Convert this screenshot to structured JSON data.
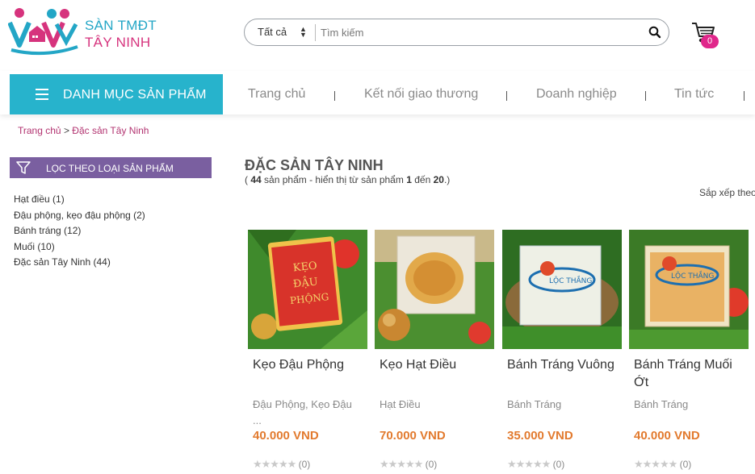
{
  "brand": {
    "line1": "SÀN TMĐT",
    "line2": "TÂY NINH"
  },
  "search": {
    "category": "Tất cả",
    "placeholder": "Tìm kiếm"
  },
  "cart": {
    "count": "0"
  },
  "nav": {
    "category_button": "DANH MỤC SẢN PHẨM",
    "items": [
      "Trang chủ",
      "Kết nối giao thương",
      "Doanh nghiệp",
      "Tin tức"
    ]
  },
  "breadcrumb": {
    "home": "Trang chủ",
    "sep": ">",
    "current": "Đặc sản Tây Ninh"
  },
  "filter": {
    "title": "LỌC THEO LOẠI SẢN PHẨM",
    "items": [
      "Hạt điều (1)",
      "Đậu phộng, kẹo đậu phộng (2)",
      "Bánh tráng (12)",
      "Muối (10)",
      "Đặc sản Tây Ninh (44)"
    ]
  },
  "listing": {
    "title": "ĐẶC SẢN TÂY NINH",
    "count_prefix": "(",
    "total": "44",
    "count_mid": "sản phẩm - hiển thị từ sản phẩm",
    "from": "1",
    "count_to": "đến",
    "to": "20",
    "count_suffix": ".)",
    "sort_label": "Sắp xếp theo"
  },
  "products": [
    {
      "name": "Kẹo Đậu Phộng",
      "category": "Đậu Phộng, Kẹo Đậu ...",
      "price": "40.000 VND",
      "stars": "★★★★★",
      "reviews": "(0)"
    },
    {
      "name": "Kẹo Hạt Điều",
      "category": "Hạt Điều",
      "price": "70.000 VND",
      "stars": "★★★★★",
      "reviews": "(0)"
    },
    {
      "name": "Bánh Tráng Vuông",
      "category": "Bánh Tráng",
      "price": "35.000 VND",
      "stars": "★★★★★",
      "reviews": "(0)"
    },
    {
      "name": "Bánh Tráng Muối Ớt",
      "category": "Bánh Tráng",
      "price": "40.000 VND",
      "stars": "★★★★★",
      "reviews": "(0)"
    }
  ],
  "colors": {
    "accent": "#27b3cc",
    "brand_pink": "#d6337d",
    "filter_purple": "#7a5fa0",
    "price_orange": "#e27a2e"
  },
  "icons": [
    "logo-people-icon",
    "chevron-updown-icon",
    "search-icon",
    "cart-icon",
    "hamburger-icon",
    "filter-funnel-icon",
    "star-icon"
  ]
}
